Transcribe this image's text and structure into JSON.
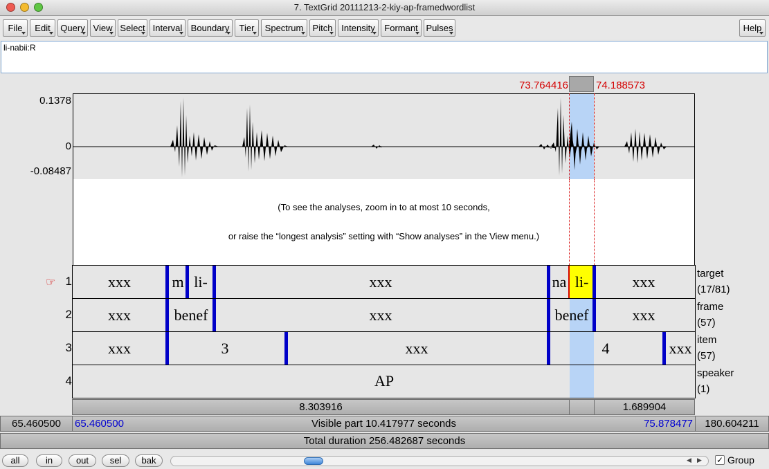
{
  "window": {
    "title": "7. TextGrid 20111213-2-kiy-ap-framedwordlist"
  },
  "menu": [
    "File",
    "Edit",
    "Query",
    "View",
    "Select",
    "Interval",
    "Boundary",
    "Tier",
    "Spectrum",
    "Pitch",
    "Intensity",
    "Formant",
    "Pulses"
  ],
  "help_label": "Help",
  "text_field": {
    "value": "li-nabii:R"
  },
  "selection": {
    "start": "73.764416",
    "end": "74.188573"
  },
  "waveform": {
    "ymax": "0.1378",
    "zero": "0",
    "ymin": "-0.08487"
  },
  "analysis_message": {
    "line1": "(To see the analyses, zoom in to at most 10 seconds,",
    "line2": "or raise the “longest analysis” setting with “Show analyses” in the View menu.)"
  },
  "tiers": [
    {
      "number": "1",
      "name": "target",
      "count": "(17/81)",
      "pointer": "☞",
      "labels": [
        "xxx",
        "m",
        "li-",
        "xxx",
        "na",
        "li-",
        "xxx"
      ]
    },
    {
      "number": "2",
      "name": "frame",
      "count": "(57)",
      "labels": [
        "xxx",
        "benef",
        "xxx",
        "benef",
        "xxx"
      ]
    },
    {
      "number": "3",
      "name": "item",
      "count": "(57)",
      "labels": [
        "xxx",
        "3",
        "xxx",
        "4",
        "xxx"
      ]
    },
    {
      "number": "4",
      "name": "speaker",
      "count": "(1)",
      "labels": [
        "AP"
      ]
    }
  ],
  "durations": {
    "before": "8.303916",
    "selected": "",
    "after": "1.689904"
  },
  "visible": {
    "left_total": "65.460500",
    "start": "65.460500",
    "label": "Visible part 10.417977 seconds",
    "end": "75.878477",
    "right_total": "180.604211"
  },
  "total_duration": "Total duration 256.482687 seconds",
  "zoom_buttons": [
    "all",
    "in",
    "out",
    "sel",
    "bak"
  ],
  "group": {
    "label": "Group",
    "checked": true
  },
  "colors": {
    "selection": "#b8d4f6",
    "boundary": "#0000c8",
    "highlight": "#ffff00",
    "red": "#d40000",
    "blue": "#0000d0"
  }
}
